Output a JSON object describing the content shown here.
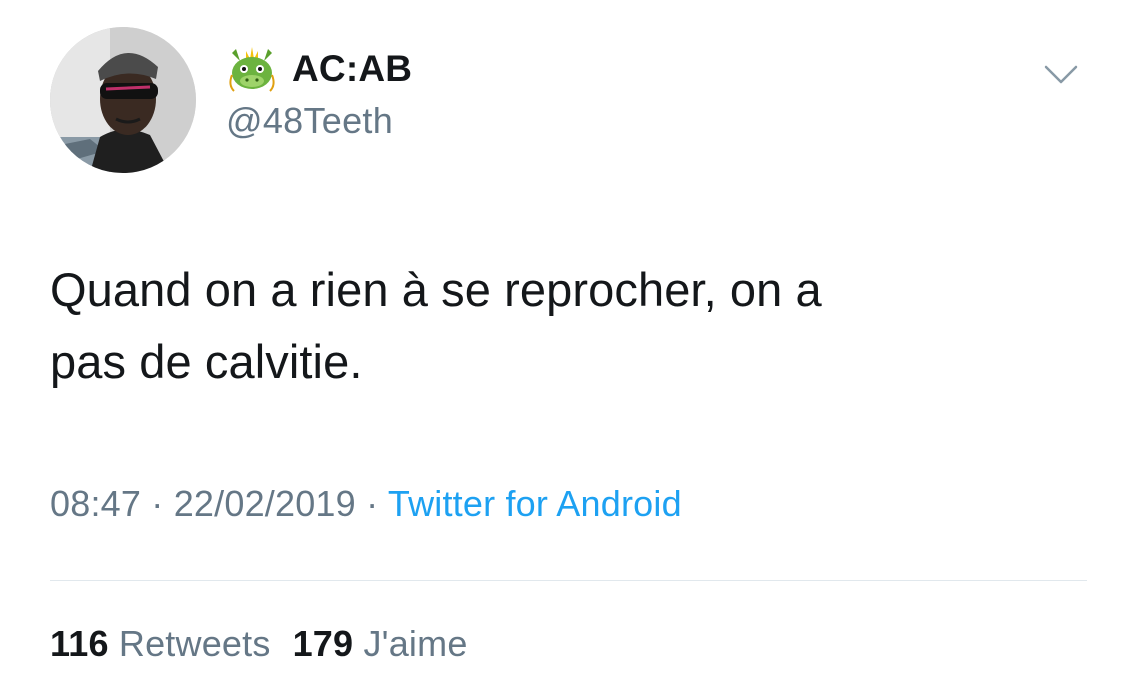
{
  "tweet": {
    "author": {
      "display_name": "AC:AB",
      "handle": "@48Teeth",
      "name_emoji": "dragon-face-emoji"
    },
    "text_line1": "Quand on a rien à se reprocher, on a",
    "text_line2": "pas de calvitie.",
    "meta": {
      "time": "08:47",
      "separator": "·",
      "date": "22/02/2019",
      "source": "Twitter for Android"
    },
    "stats": {
      "retweets_count": "116",
      "retweets_label": "Retweets",
      "likes_count": "179",
      "likes_label": "J'aime"
    },
    "menu_icon": "chevron-down-icon"
  },
  "colors": {
    "text": "#14171a",
    "secondary": "#657786",
    "link": "#1da1f2",
    "divider": "#e1e8ed"
  }
}
